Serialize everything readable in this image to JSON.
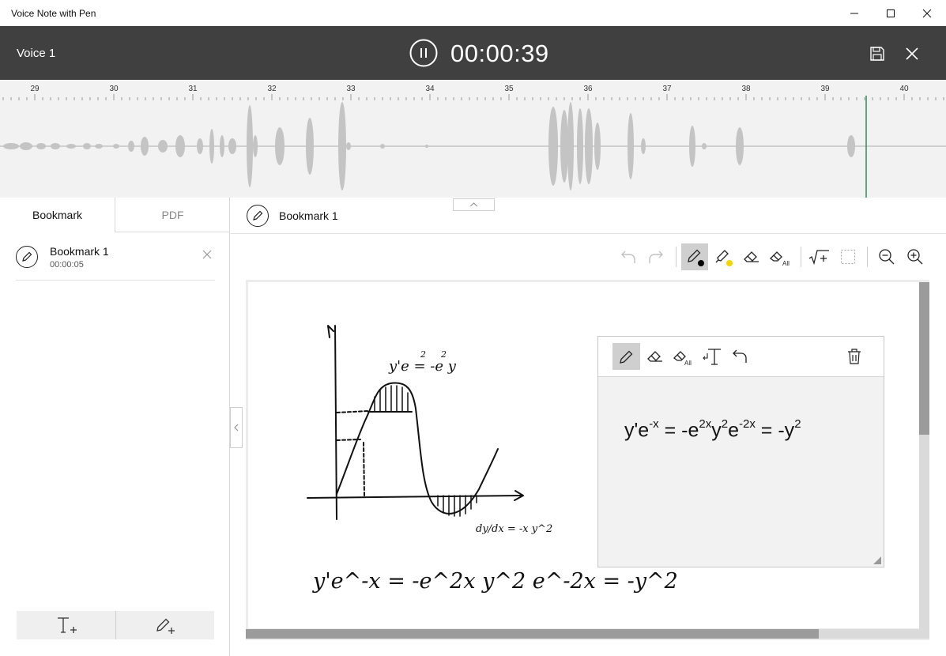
{
  "window": {
    "title": "Voice Note with Pen",
    "controls": [
      "minimize-icon",
      "maximize-icon",
      "close-icon"
    ]
  },
  "recorder": {
    "voice_name": "Voice 1",
    "timer": "00:00:39",
    "state_icon": "pause-icon",
    "actions": [
      "save-icon",
      "close-icon"
    ]
  },
  "timeline": {
    "tick_labels": [
      "29",
      "30",
      "31",
      "32",
      "33",
      "34",
      "35",
      "36",
      "37",
      "38",
      "39",
      "40"
    ],
    "playhead_color": "#2e8b57"
  },
  "tabs": [
    {
      "label": "Bookmark",
      "selected": true
    },
    {
      "label": "PDF",
      "selected": false
    }
  ],
  "bookmarks": [
    {
      "title": "Bookmark 1",
      "time": "00:00:05",
      "icon": "pen-icon"
    }
  ],
  "bottom_actions": [
    "add-text-icon",
    "add-ink-icon"
  ],
  "editor": {
    "header_title": "Bookmark 1",
    "toolbar": [
      "undo-icon",
      "redo-icon",
      "pen-icon",
      "highlighter-icon",
      "eraser-icon",
      "erase-all-icon",
      "math-icon",
      "selection-icon",
      "zoom-out-icon",
      "zoom-in-icon"
    ],
    "pen_color": "#000000",
    "highlighter_color": "#f5d400"
  },
  "recognition": {
    "toolbar": [
      "pen-icon",
      "eraser-icon",
      "erase-all-icon",
      "insert-text-icon",
      "undo-icon",
      "delete-icon"
    ],
    "erase_all_badge": "All",
    "math": {
      "p1": "y'e",
      "s1": "-x",
      "p2": " = -e",
      "s2": "2x",
      "p3": "y",
      "s3": "2",
      "p4": "e",
      "s4": "-2x",
      "p5": " = -y",
      "s5": "2"
    }
  },
  "canvas_ink": {
    "curve_label": "y'e = -e y",
    "exponent_x": "-x",
    "exponent_2": "2",
    "bottom_equation": "y'e^-x = -e^2x y^2 e^-2x = -y^2",
    "annotation": "dy/dx = -x y^2"
  }
}
